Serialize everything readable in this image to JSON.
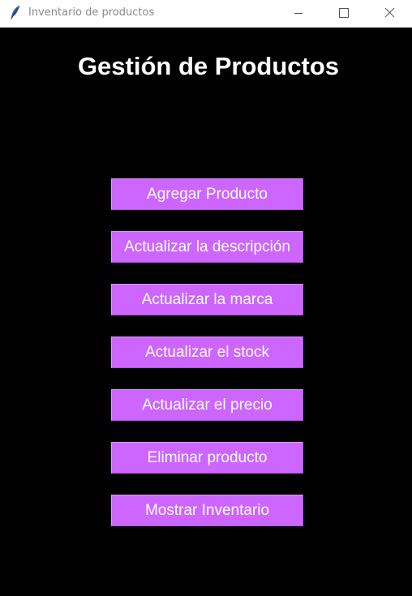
{
  "window": {
    "title": "Inventario de productos",
    "app_icon": "feather-icon",
    "controls": [
      "minimize-icon",
      "maximize-icon",
      "close-icon"
    ]
  },
  "main": {
    "heading": "Gestión de Productos",
    "buttons": [
      {
        "label": "Agregar Producto"
      },
      {
        "label": "Actualizar la descripción"
      },
      {
        "label": "Actualizar la marca"
      },
      {
        "label": "Actualizar el stock"
      },
      {
        "label": "Actualizar el precio"
      },
      {
        "label": "Eliminar producto"
      },
      {
        "label": "Mostrar Inventario"
      }
    ]
  },
  "colors": {
    "background": "#000000",
    "button": "#cc66ff",
    "button_text": "#ffffff",
    "heading_text": "#ffffff",
    "titlebar": "#ffffff"
  }
}
